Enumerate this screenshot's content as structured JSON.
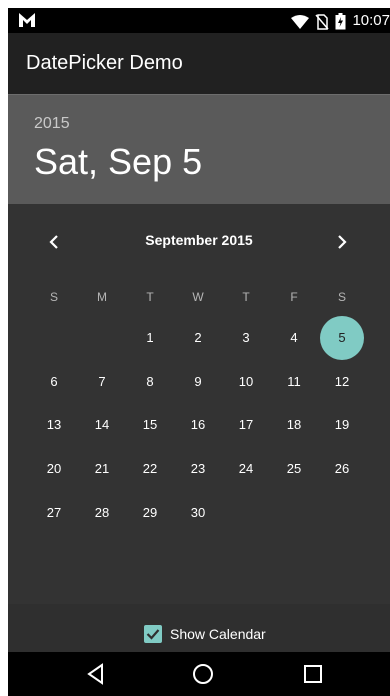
{
  "status_bar": {
    "time": "10:07",
    "icons": [
      "m-logo-icon",
      "wifi-icon",
      "no-sim-icon",
      "battery-charging-icon"
    ]
  },
  "app_bar": {
    "title": "DatePicker Demo"
  },
  "picker_header": {
    "year": "2015",
    "date": "Sat, Sep 5"
  },
  "calendar": {
    "month_label": "September 2015",
    "prev_icon": "chevron-left-icon",
    "next_icon": "chevron-right-icon",
    "weekdays": [
      "S",
      "M",
      "T",
      "W",
      "T",
      "F",
      "S"
    ],
    "leading_blanks": 2,
    "days": [
      "1",
      "2",
      "3",
      "4",
      "5",
      "6",
      "7",
      "8",
      "9",
      "10",
      "11",
      "12",
      "13",
      "14",
      "15",
      "16",
      "17",
      "18",
      "19",
      "20",
      "21",
      "22",
      "23",
      "24",
      "25",
      "26",
      "27",
      "28",
      "29",
      "30"
    ],
    "selected_day": "5",
    "accent_color": "#80cbc4"
  },
  "footer": {
    "show_calendar_label": "Show Calendar",
    "show_calendar_checked": true
  },
  "nav_bar": {
    "icons": [
      "back-icon",
      "home-icon",
      "recents-icon"
    ]
  }
}
